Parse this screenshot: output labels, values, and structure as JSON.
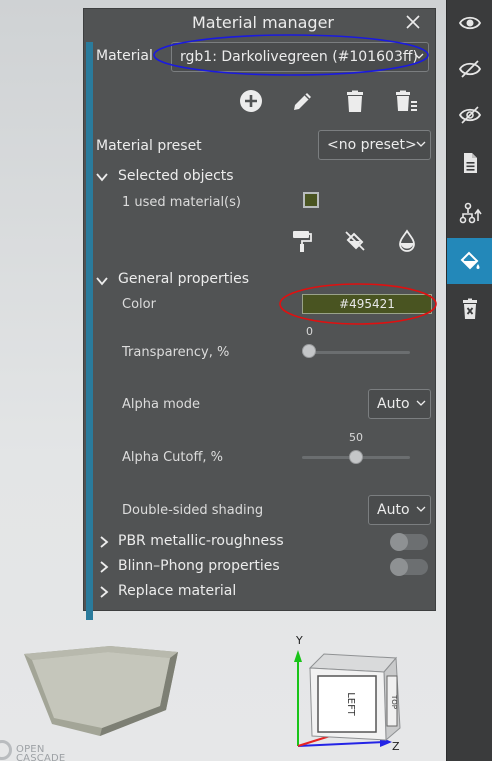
{
  "panel": {
    "title": "Material manager",
    "material_label": "Material",
    "material_value": "rgb1: Darkolivegreen (#101603ff)",
    "preset_label": "Material preset",
    "preset_value": "<no preset>",
    "selected_objects": {
      "header": "Selected objects",
      "used_materials": "1 used material(s)",
      "swatch_color": "#495421"
    },
    "general": {
      "header": "General properties",
      "color_label": "Color",
      "color_value": "#495421",
      "transparency_label": "Transparency, %",
      "transparency_value": "0",
      "alpha_mode_label": "Alpha mode",
      "alpha_mode_value": "Auto",
      "alpha_cutoff_label": "Alpha Cutoff, %",
      "alpha_cutoff_value": "50",
      "double_sided_label": "Double-sided shading",
      "double_sided_value": "Auto"
    },
    "sections": {
      "pbr": "PBR metallic-roughness",
      "blinn": "Blinn–Phong properties",
      "replace": "Replace material"
    }
  },
  "viewport": {
    "logo_text_line1": "OPEN",
    "logo_text_line2": "CASCADE",
    "viewcube_face_front": "LEFT",
    "viewcube_face_side": "TOP",
    "axis_z": "Z",
    "axis_y": "Y"
  },
  "toolbar": {
    "icons": [
      "eye-icon",
      "eye-slash-icon",
      "eye-toggle-icon",
      "document-icon",
      "hierarchy-icon",
      "paint-bucket-icon",
      "delete-icon"
    ],
    "active_index": 5
  },
  "colors": {
    "accent": "#2388b9",
    "material_swatch": "#495421",
    "annotation_blue": "#1a1adf",
    "annotation_red": "#e01010"
  }
}
